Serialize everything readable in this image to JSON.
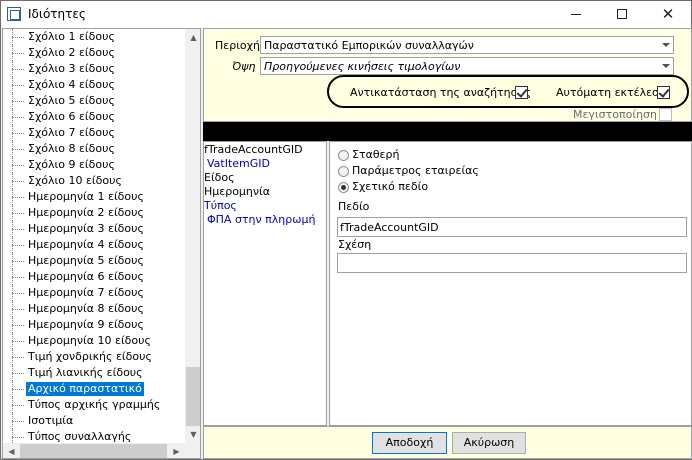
{
  "window": {
    "title": "Ιδιότητες"
  },
  "tree": {
    "items": [
      {
        "label": "Σχόλιο 1 είδους"
      },
      {
        "label": "Σχόλιο 2 είδους"
      },
      {
        "label": "Σχόλιο 3 είδους"
      },
      {
        "label": "Σχόλιο 4 είδους"
      },
      {
        "label": "Σχόλιο 5 είδους"
      },
      {
        "label": "Σχόλιο 6 είδους"
      },
      {
        "label": "Σχόλιο 7 είδους"
      },
      {
        "label": "Σχόλιο 8 είδους"
      },
      {
        "label": "Σχόλιο 9 είδους"
      },
      {
        "label": "Σχόλιο 10 είδους"
      },
      {
        "label": "Ημερομηνία 1 είδους"
      },
      {
        "label": "Ημερομηνία 2 είδους"
      },
      {
        "label": "Ημερομηνία 3 είδους"
      },
      {
        "label": "Ημερομηνία 4 είδους"
      },
      {
        "label": "Ημερομηνία 5 είδους"
      },
      {
        "label": "Ημερομηνία 6 είδους"
      },
      {
        "label": "Ημερομηνία 7 είδους"
      },
      {
        "label": "Ημερομηνία 8 είδους"
      },
      {
        "label": "Ημερομηνία 9 είδους"
      },
      {
        "label": "Ημερομηνία 10 είδους"
      },
      {
        "label": "Τιμή χονδρικής είδους"
      },
      {
        "label": "Τιμή λιανικής είδους"
      },
      {
        "label": "Αρχικό παραστατικό",
        "selected": true
      },
      {
        "label": "Τύπος αρχικής γραμμής"
      },
      {
        "label": "Ισοτιμία"
      },
      {
        "label": "Τύπος συναλλαγής"
      }
    ]
  },
  "filters": {
    "area_label": "Περιοχή",
    "area_value": "Παραστατικό Εμπορικών συναλλαγών",
    "view_label": "Όψη",
    "view_value": "Προηγούμενες κινήσεις τιμολογίων",
    "replace_search_label": "Αντικατάσταση της αναζήτησης",
    "replace_search_checked": true,
    "auto_run_label": "Αυτόματη εκτέλεση",
    "auto_run_checked": true,
    "maximize_label": "Μεγιστοποίηση",
    "maximize_checked": false
  },
  "field_list": {
    "items": [
      {
        "label": "fTradeAccountGID",
        "color": "#000000"
      },
      {
        "label": "VatItemGID",
        "color": "#0000c0"
      },
      {
        "label": "Είδος",
        "color": "#000000"
      },
      {
        "label": "Ημερομηνία",
        "color": "#000000"
      },
      {
        "label": "Τύπος",
        "color": "#0000c0"
      },
      {
        "label": "ΦΠΑ στην πληρωμή",
        "color": "#0000c0"
      }
    ]
  },
  "detail": {
    "options": [
      {
        "label": "Σταθερή",
        "checked": false
      },
      {
        "label": "Παράμετρος εταιρείας",
        "checked": false
      },
      {
        "label": "Σχετικό πεδίο",
        "checked": true
      }
    ],
    "field_label": "Πεδίο",
    "field_value": "fTradeAccountGID",
    "relation_label": "Σχέση",
    "relation_value": ""
  },
  "buttons": {
    "ok": "Αποδοχή",
    "cancel": "Ακύρωση"
  }
}
